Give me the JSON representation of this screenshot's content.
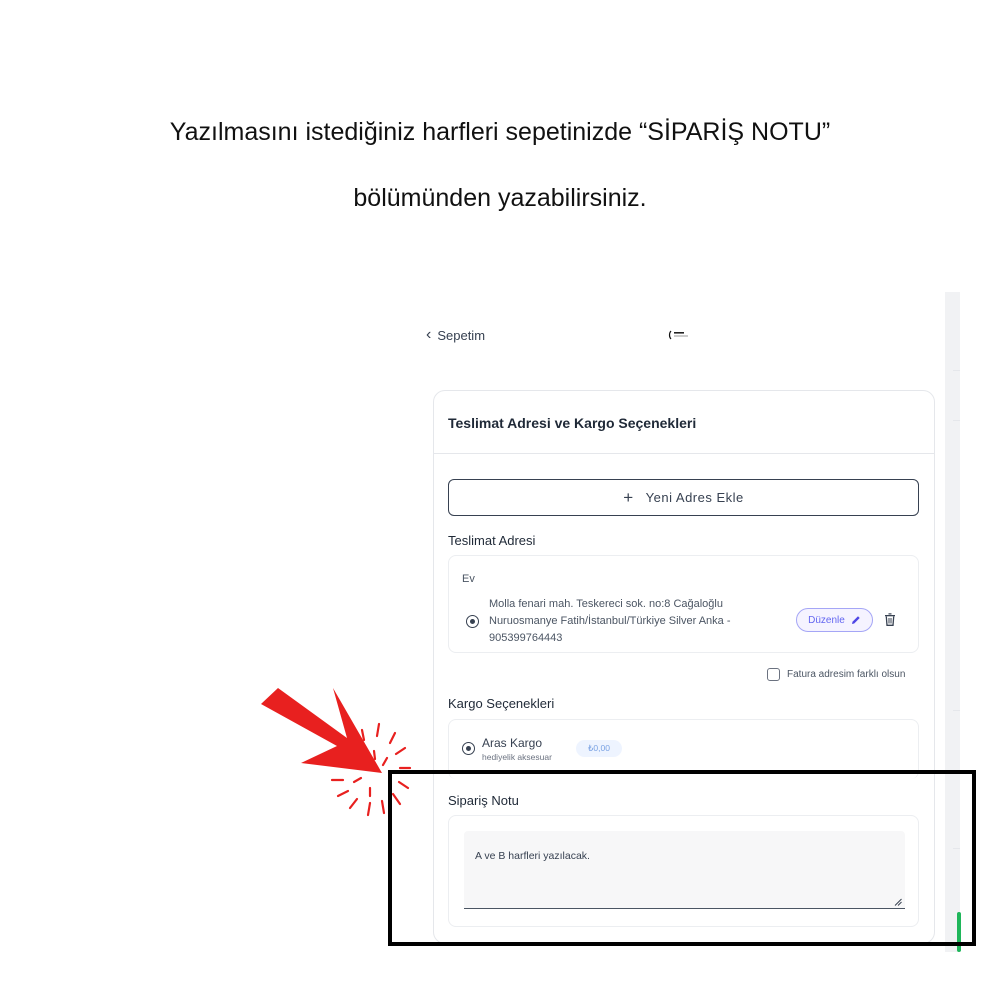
{
  "instruction": {
    "line1": "Yazılmasını istediğiniz harfleri sepetinizde “SİPARİŞ NOTU”",
    "line2": "bölümünden yazabilirsiniz."
  },
  "topbar": {
    "back_label": "Sepetim",
    "back_icon": "chevron-left-icon",
    "logo_icon": "brand-logo-icon"
  },
  "card": {
    "title": "Teslimat Adresi ve Kargo Seçenekleri",
    "add_address_label": "Yeni Adres Ekle",
    "add_address_icon": "plus-icon",
    "delivery_address_label": "Teslimat Adresi",
    "address": {
      "name": "Ev",
      "lines": [
        "Molla fenari mah. Teskereci sok. no:8 Cağaloğlu",
        "Nuruosmanye Fatih/İstanbul/Türkiye Silver Anka -",
        "905399764443"
      ],
      "selected": true,
      "edit_label": "Düzenle",
      "edit_icon": "pencil-icon",
      "delete_icon": "trash-icon"
    },
    "billing_checkbox_label": "Fatura adresim farklı olsun",
    "billing_checked": false,
    "cargo_label": "Kargo Seçenekleri",
    "cargo_option": {
      "name": "Aras Kargo",
      "subtitle": "hediyelik aksesuar",
      "price": "₺0,00",
      "selected": true
    },
    "order_note_label": "Sipariş Notu",
    "order_note_value": "A ve B harfleri yazılacak."
  },
  "colors": {
    "accent_purple": "#6366f1",
    "highlight_border": "#000000",
    "arrow_red": "#e8201f",
    "status_green": "#1fb65a"
  },
  "annotation": {
    "arrow_icon": "red-arrow-icon",
    "highlight": "highlight-box"
  }
}
